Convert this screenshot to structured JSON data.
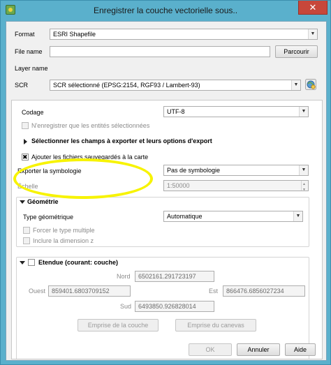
{
  "window": {
    "title": "Enregistrer la couche vectorielle sous..",
    "close_label": "✕"
  },
  "form": {
    "format_label": "Format",
    "format_value": "ESRI Shapefile",
    "file_name_label": "File name",
    "file_name_value": "",
    "browse_label": "Parcourir",
    "layer_name_label": "Layer name",
    "crs_label": "SCR",
    "crs_value": "SCR sélectionné (EPSG:2154, RGF93 / Lambert-93)"
  },
  "options": {
    "encoding_label": "Codage",
    "encoding_value": "UTF-8",
    "selected_only_label": "N'enregistrer que les entités sélectionnées",
    "fields_section_label": "Sélectionner les champs à exporter et leurs options d'export",
    "add_to_map_label": "Ajouter les fichiers sauvegardés à la carte",
    "add_to_map_checked": true,
    "symbology_label": "Exporter la symbologie",
    "symbology_value": "Pas de symbologie",
    "scale_label": "Échelle",
    "scale_value": "1:50000"
  },
  "geometry": {
    "section_label": "Géométrie",
    "type_label": "Type géométrique",
    "type_value": "Automatique",
    "force_multi_label": "Forcer le type multiple",
    "include_z_label": "Inclure la dimension z"
  },
  "extent": {
    "section_label": "Etendue (courant: couche)",
    "north_label": "Nord",
    "north_value": "6502161.291723197",
    "west_label": "Ouest",
    "west_value": "859401.6803709152",
    "east_label": "Est",
    "east_value": "866476.6856027234",
    "south_label": "Sud",
    "south_value": "6493850.926828014",
    "layer_extent_button": "Emprise de la couche",
    "canvas_extent_button": "Emprise du canevas"
  },
  "buttons": {
    "ok": "OK",
    "cancel": "Annuler",
    "help": "Aide"
  },
  "colors": {
    "titlebar": "#5ab0cc",
    "close": "#c7473a",
    "annotation_highlight": "#f7f300"
  }
}
